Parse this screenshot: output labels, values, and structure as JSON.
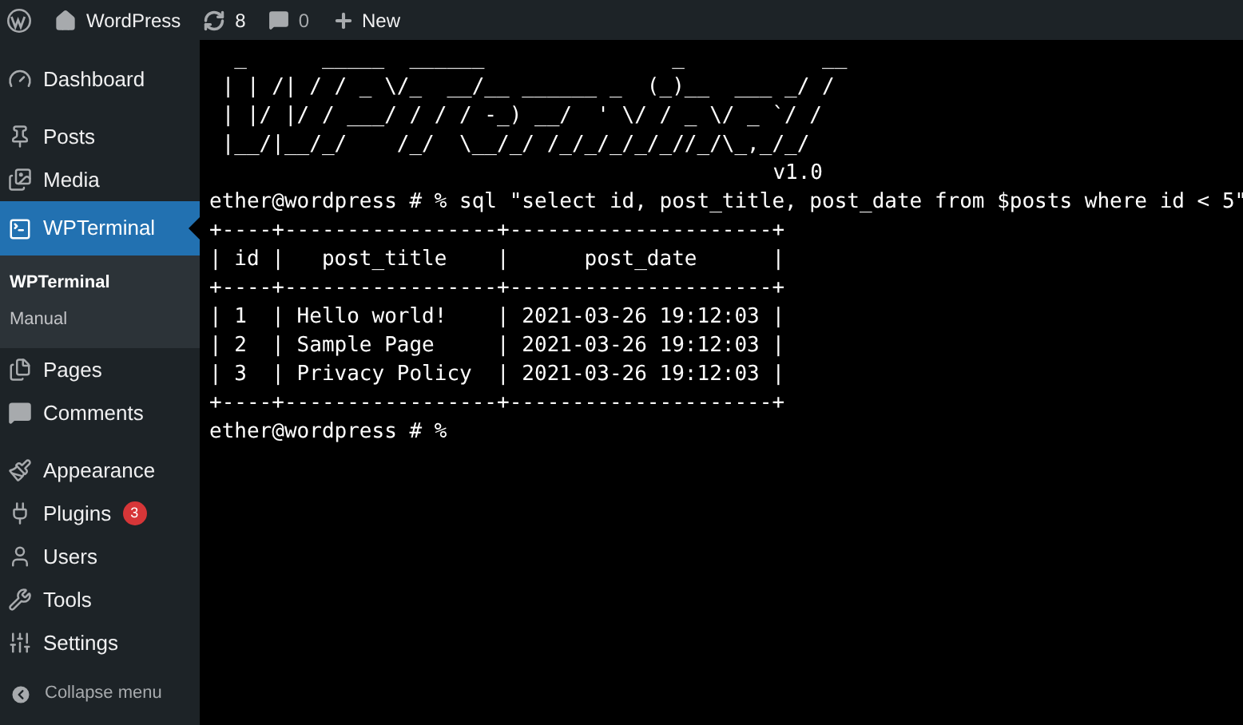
{
  "admin_bar": {
    "site_name": "WordPress",
    "updates_count": "8",
    "comments_count": "0",
    "new_label": "New"
  },
  "sidebar": {
    "groups": [
      [
        {
          "label": "Dashboard",
          "selected": false
        }
      ],
      [
        {
          "label": "Posts",
          "selected": false
        },
        {
          "label": "Media",
          "selected": false
        },
        {
          "label": "WPTerminal",
          "selected": true,
          "children": [
            {
              "label": "WPTerminal",
              "selected": true
            },
            {
              "label": "Manual",
              "selected": false
            }
          ]
        },
        {
          "label": "Pages",
          "selected": false
        },
        {
          "label": "Comments",
          "selected": false
        }
      ],
      [
        {
          "label": "Appearance",
          "selected": false
        },
        {
          "label": "Plugins",
          "selected": false,
          "badge": "3"
        },
        {
          "label": "Users",
          "selected": false
        },
        {
          "label": "Tools",
          "selected": false
        },
        {
          "label": "Settings",
          "selected": false
        }
      ]
    ],
    "collapse_label": "Collapse menu"
  },
  "terminal": {
    "banner": [
      "  _      _____  ______               _           __",
      " | | /| / / _ \\/_  __/__ ______ _  (_)__  ___ _/ /",
      " | |/ |/ / ___/ / / / -_) __/  ' \\/ / _ \\/ _ `/ / ",
      " |__/|__/_/    /_/  \\__/_/ /_/_/_/_/_//_/\\_,_/_/  "
    ],
    "version": "v1.0",
    "lines": [
      "ether@wordpress # % sql \"select id, post_title, post_date from $posts where id < 5\"",
      "+----+-----------------+---------------------+",
      "| id |   post_title    |      post_date      |",
      "+----+-----------------+---------------------+",
      "| 1  | Hello world!    | 2021-03-26 19:12:03 |",
      "| 2  | Sample Page     | 2021-03-26 19:12:03 |",
      "| 3  | Privacy Policy  | 2021-03-26 19:12:03 |",
      "+----+-----------------+---------------------+",
      "ether@wordpress # %"
    ]
  }
}
